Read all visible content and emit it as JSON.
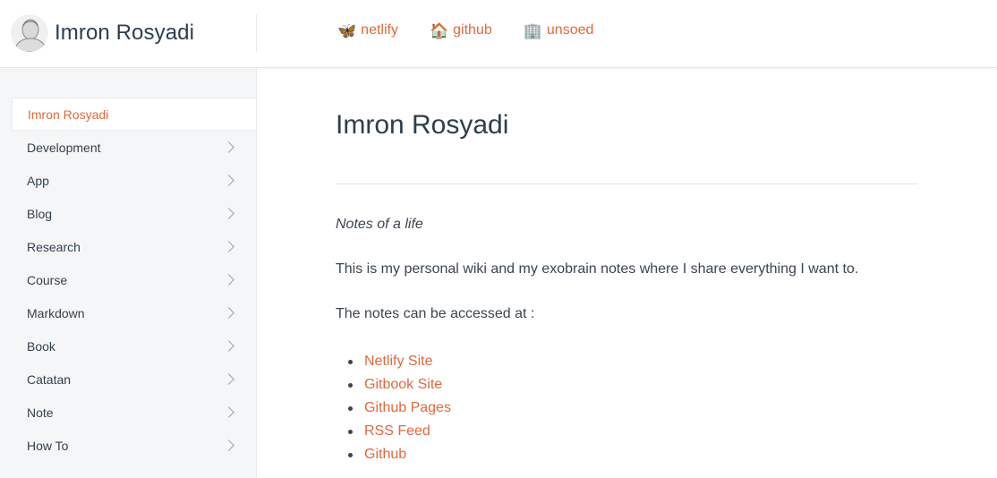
{
  "header": {
    "title": "Imron Rosyadi",
    "avatar_icon": "person-sketch-avatar",
    "nav": [
      {
        "label": "netlify",
        "icon": "butterfly-icon",
        "glyph": "🦋"
      },
      {
        "label": "github",
        "icon": "house-icon",
        "glyph": "🏠"
      },
      {
        "label": "unsoed",
        "icon": "office-building-icon",
        "glyph": "🏢"
      }
    ]
  },
  "sidebar": {
    "items": [
      {
        "label": "Imron Rosyadi",
        "active": true
      },
      {
        "label": "Development"
      },
      {
        "label": "App"
      },
      {
        "label": "Blog"
      },
      {
        "label": "Research"
      },
      {
        "label": "Course"
      },
      {
        "label": "Markdown"
      },
      {
        "label": "Book"
      },
      {
        "label": "Catatan"
      },
      {
        "label": "Note"
      },
      {
        "label": "How To"
      }
    ]
  },
  "main": {
    "title": "Imron Rosyadi",
    "tagline": "Notes of a life",
    "intro": "This is my personal wiki and my exobrain notes where I share everything I want to.",
    "access_text": "The notes can be accessed at :",
    "links": [
      "Netlify Site",
      "Gitbook Site",
      "Github Pages",
      "RSS Feed",
      "Github"
    ]
  },
  "colors": {
    "accent": "#e4683c",
    "text": "#2c3e50",
    "sidebar_bg": "#f5f6f7"
  }
}
